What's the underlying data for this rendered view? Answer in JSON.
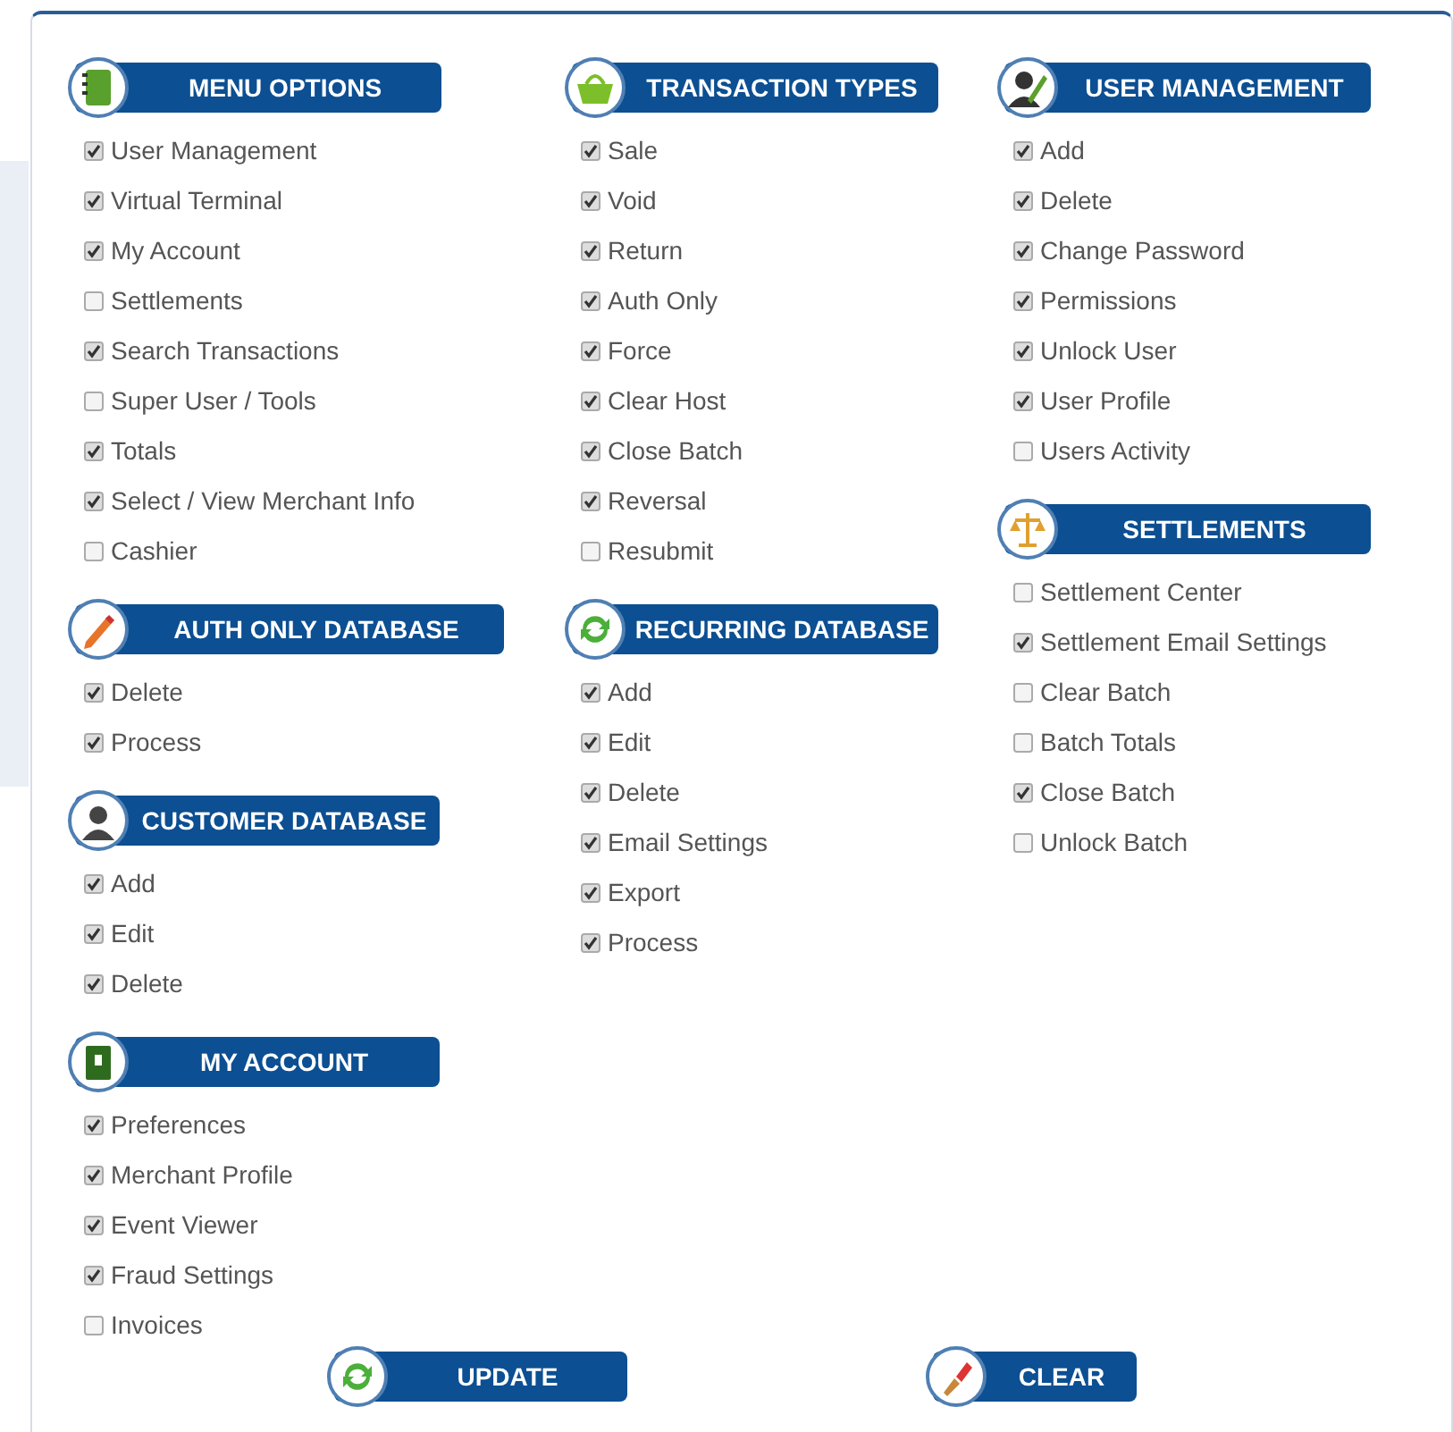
{
  "columns": [
    {
      "sections": [
        {
          "title": "MENU OPTIONS",
          "items": [
            {
              "label": "User Management",
              "checked": true
            },
            {
              "label": "Virtual Terminal",
              "checked": true
            },
            {
              "label": "My Account",
              "checked": true
            },
            {
              "label": "Settlements",
              "checked": false
            },
            {
              "label": "Search Transactions",
              "checked": true
            },
            {
              "label": "Super User / Tools",
              "checked": false
            },
            {
              "label": "Totals",
              "checked": true
            },
            {
              "label": "Select / View Merchant Info",
              "checked": true
            },
            {
              "label": "Cashier",
              "checked": false
            }
          ]
        },
        {
          "title": "AUTH ONLY DATABASE",
          "items": [
            {
              "label": "Delete",
              "checked": true
            },
            {
              "label": "Process",
              "checked": true
            }
          ]
        },
        {
          "title": "CUSTOMER DATABASE",
          "items": [
            {
              "label": "Add",
              "checked": true
            },
            {
              "label": "Edit",
              "checked": true
            },
            {
              "label": "Delete",
              "checked": true
            }
          ]
        },
        {
          "title": "MY ACCOUNT",
          "items": [
            {
              "label": "Preferences",
              "checked": true
            },
            {
              "label": "Merchant Profile",
              "checked": true
            },
            {
              "label": "Event Viewer",
              "checked": true
            },
            {
              "label": "Fraud Settings",
              "checked": true
            },
            {
              "label": "Invoices",
              "checked": false
            }
          ]
        }
      ]
    },
    {
      "sections": [
        {
          "title": "TRANSACTION TYPES",
          "items": [
            {
              "label": "Sale",
              "checked": true
            },
            {
              "label": "Void",
              "checked": true
            },
            {
              "label": "Return",
              "checked": true
            },
            {
              "label": "Auth Only",
              "checked": true
            },
            {
              "label": "Force",
              "checked": true
            },
            {
              "label": "Clear Host",
              "checked": true
            },
            {
              "label": "Close Batch",
              "checked": true
            },
            {
              "label": "Reversal",
              "checked": true
            },
            {
              "label": "Resubmit",
              "checked": false
            }
          ]
        },
        {
          "title": "RECURRING DATABASE",
          "items": [
            {
              "label": "Add",
              "checked": true
            },
            {
              "label": "Edit",
              "checked": true
            },
            {
              "label": "Delete",
              "checked": true
            },
            {
              "label": "Email Settings",
              "checked": true
            },
            {
              "label": "Export",
              "checked": true
            },
            {
              "label": "Process",
              "checked": true
            }
          ]
        }
      ]
    },
    {
      "sections": [
        {
          "title": "USER MANAGEMENT",
          "items": [
            {
              "label": "Add",
              "checked": true
            },
            {
              "label": "Delete",
              "checked": true
            },
            {
              "label": "Change Password",
              "checked": true
            },
            {
              "label": "Permissions",
              "checked": true
            },
            {
              "label": "Unlock User",
              "checked": true
            },
            {
              "label": "User Profile",
              "checked": true
            },
            {
              "label": "Users Activity",
              "checked": false
            }
          ]
        },
        {
          "title": "SETTLEMENTS",
          "items": [
            {
              "label": "Settlement Center",
              "checked": false
            },
            {
              "label": "Settlement Email Settings",
              "checked": true
            },
            {
              "label": "Clear Batch",
              "checked": false
            },
            {
              "label": "Batch Totals",
              "checked": false
            },
            {
              "label": "Close Batch",
              "checked": true
            },
            {
              "label": "Unlock Batch",
              "checked": false
            }
          ]
        }
      ]
    }
  ],
  "buttons": [
    {
      "label": "UPDATE"
    },
    {
      "label": "CLEAR"
    }
  ]
}
